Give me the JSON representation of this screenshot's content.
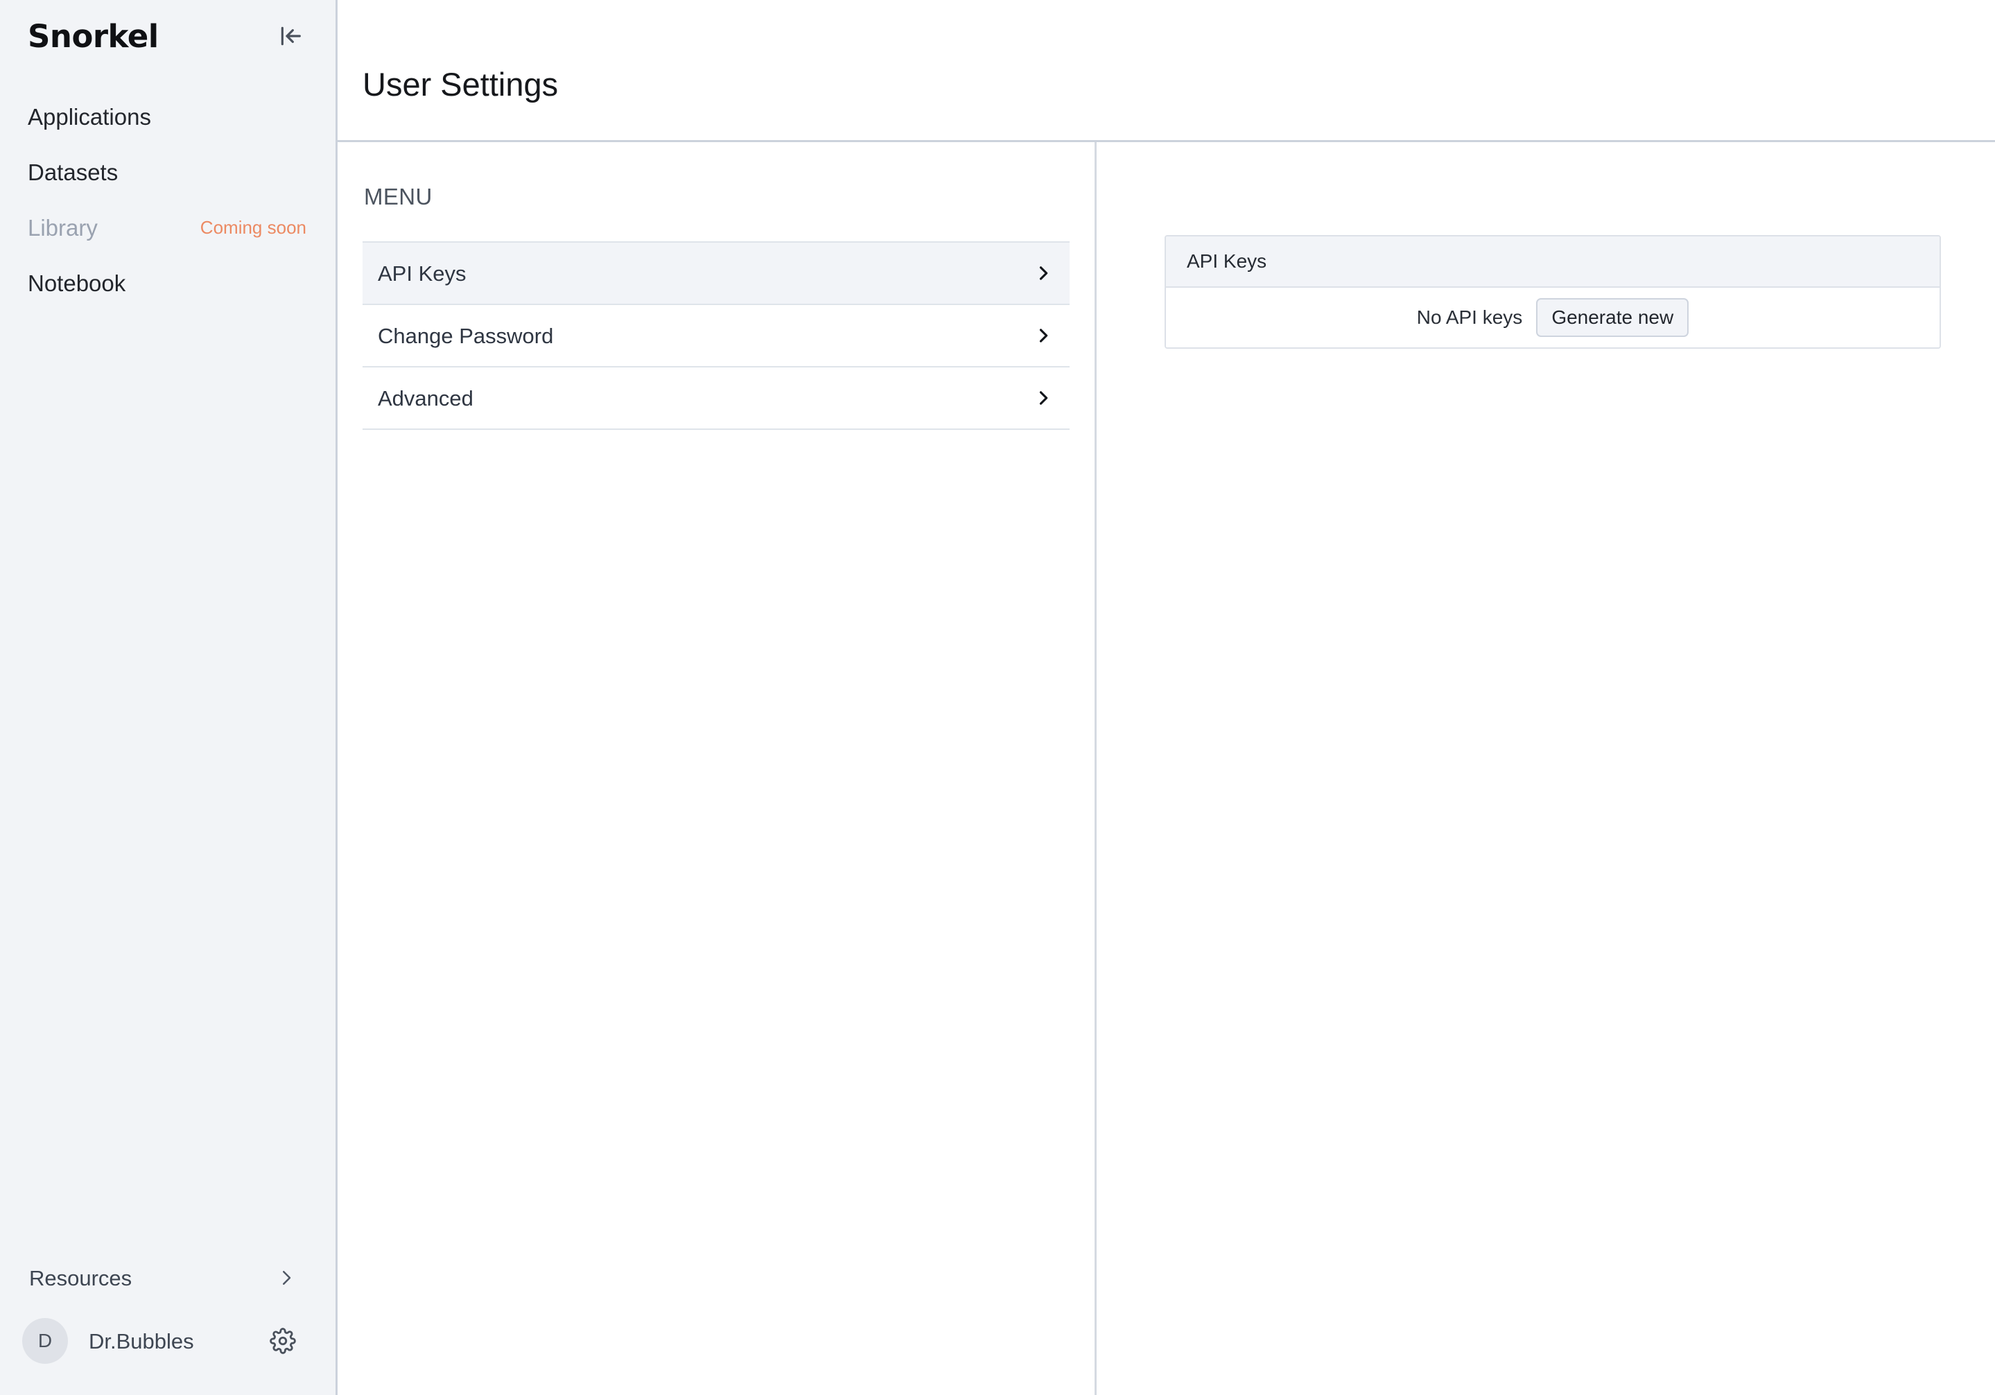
{
  "sidebar": {
    "brand": "Snorkel",
    "collapse_icon": "collapse-left-icon",
    "nav_items": [
      {
        "label": "Applications",
        "badge": null,
        "disabled": false
      },
      {
        "label": "Datasets",
        "badge": null,
        "disabled": false
      },
      {
        "label": "Library",
        "badge": "Coming soon",
        "disabled": true
      },
      {
        "label": "Notebook",
        "badge": null,
        "disabled": false
      }
    ],
    "resources": {
      "label": "Resources",
      "icon": "chevron-right-icon"
    },
    "user": {
      "avatar_initial": "D",
      "name": "Dr.Bubbles",
      "settings_icon": "gear-icon"
    }
  },
  "header": {
    "title": "User Settings"
  },
  "menu": {
    "heading": "MENU",
    "items": [
      {
        "label": "API Keys",
        "selected": true,
        "icon": "chevron-right-icon"
      },
      {
        "label": "Change Password",
        "selected": false,
        "icon": "chevron-right-icon"
      },
      {
        "label": "Advanced",
        "selected": false,
        "icon": "chevron-right-icon"
      }
    ]
  },
  "content": {
    "api_keys_card": {
      "header_title": "API Keys",
      "empty_text": "No API keys",
      "generate_button_label": "Generate new"
    }
  },
  "colors": {
    "sidebar_bg": "#F2F4F7",
    "accent_orange": "#EC8A63",
    "border": "#CCD2DC",
    "selected_row_bg": "#F2F4F8",
    "text_primary": "#23262C",
    "text_muted": "#9AA2B0"
  }
}
